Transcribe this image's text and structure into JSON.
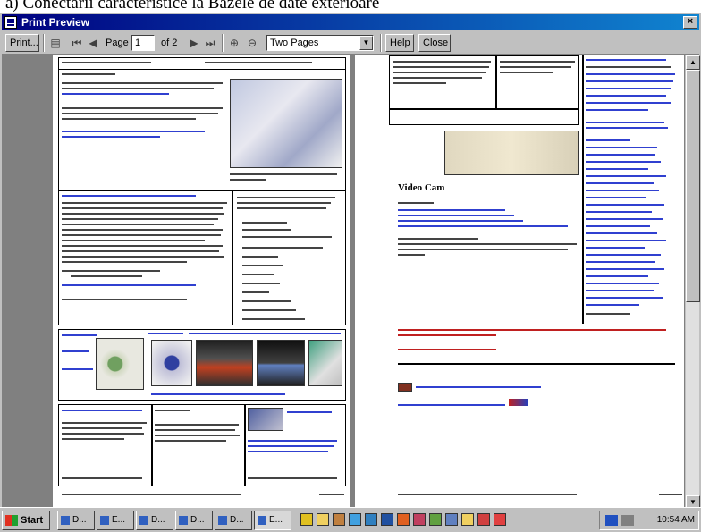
{
  "document_heading": "a) Conectarii caracteristice la Bazele de date exterioare",
  "window": {
    "title": "Print Preview",
    "close_glyph": "×"
  },
  "toolbar": {
    "print_label": "Print...",
    "page_label": "Page",
    "page_value": "1",
    "page_total": "of 2",
    "view_mode": "Two Pages",
    "help_label": "Help",
    "close_label": "Close"
  },
  "page2_text": {
    "section_title": "Video Cam"
  },
  "taskbar": {
    "start_label": "Start",
    "tasks": [
      "D...",
      "E...",
      "D...",
      "D...",
      "D...",
      "E..."
    ],
    "clock": "10:54 AM"
  },
  "colors": {
    "title_gradient_start": "#000080",
    "title_gradient_end": "#1084d0",
    "chrome": "#c0c0c0",
    "link": "#3040d0",
    "link_red": "#c02020"
  }
}
